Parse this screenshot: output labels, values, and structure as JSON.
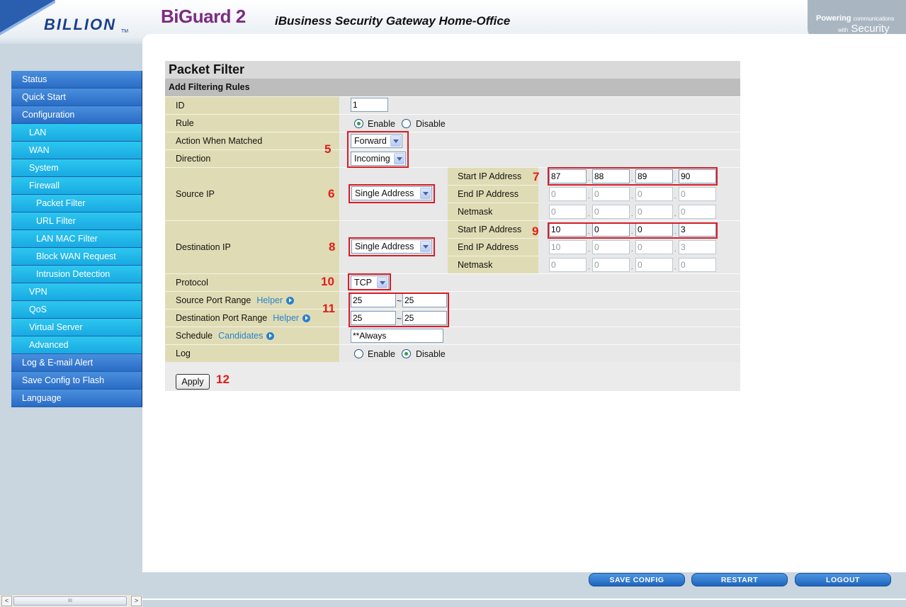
{
  "header": {
    "logo_text": "BILLION",
    "logo_tm": "TM",
    "product": "BiGuard 2",
    "subtitle": "iBusiness Security Gateway Home-Office",
    "powering": "Powering",
    "communications": "communications",
    "with": "with",
    "security": "Security"
  },
  "sidebar": {
    "items": [
      {
        "label": "Status",
        "level": 0
      },
      {
        "label": "Quick Start",
        "level": 0
      },
      {
        "label": "Configuration",
        "level": 0
      },
      {
        "label": "LAN",
        "level": 1
      },
      {
        "label": "WAN",
        "level": 1
      },
      {
        "label": "System",
        "level": 1
      },
      {
        "label": "Firewall",
        "level": 1
      },
      {
        "label": "Packet Filter",
        "level": 2
      },
      {
        "label": "URL Filter",
        "level": 2
      },
      {
        "label": "LAN MAC Filter",
        "level": 2
      },
      {
        "label": "Block WAN Request",
        "level": 2
      },
      {
        "label": "Intrusion Detection",
        "level": 2
      },
      {
        "label": "VPN",
        "level": 1
      },
      {
        "label": "QoS",
        "level": 1
      },
      {
        "label": "Virtual Server",
        "level": 1
      },
      {
        "label": "Advanced",
        "level": 1
      },
      {
        "label": "Log & E-mail Alert",
        "level": 0
      },
      {
        "label": "Save Config to Flash",
        "level": 0
      },
      {
        "label": "Language",
        "level": 0
      }
    ]
  },
  "page": {
    "title": "Packet Filter",
    "section": "Add Filtering Rules"
  },
  "form": {
    "id_label": "ID",
    "id_value": "1",
    "rule_label": "Rule",
    "enable": "Enable",
    "disable": "Disable",
    "rule_value": "enable",
    "action_label": "Action When Matched",
    "action_value": "Forward",
    "direction_label": "Direction",
    "direction_value": "Incoming",
    "source_ip_label": "Source IP",
    "source_mode": "Single Address",
    "start_ip_label": "Start IP Address",
    "end_ip_label": "End IP Address",
    "netmask_label": "Netmask",
    "src_start": [
      "87",
      "88",
      "89",
      "90"
    ],
    "src_end": [
      "0",
      "0",
      "0",
      "0"
    ],
    "src_mask": [
      "0",
      "0",
      "0",
      "0"
    ],
    "dest_ip_label": "Destination IP",
    "dest_mode": "Single Address",
    "dst_start": [
      "10",
      "0",
      "0",
      "3"
    ],
    "dst_end": [
      "10",
      "0",
      "0",
      "3"
    ],
    "dst_mask": [
      "0",
      "0",
      "0",
      "0"
    ],
    "protocol_label": "Protocol",
    "protocol_value": "TCP",
    "src_port_label": "Source Port Range",
    "helper": "Helper",
    "src_port_from": "25",
    "src_port_to": "25",
    "dst_port_label": "Destination Port Range",
    "dst_port_from": "25",
    "dst_port_to": "25",
    "tilde": "~",
    "schedule_label": "Schedule",
    "candidates": "Candidates",
    "schedule_value": "**Always",
    "log_label": "Log",
    "log_value": "disable",
    "apply": "Apply"
  },
  "annotations": [
    "5",
    "6",
    "7",
    "8",
    "9",
    "10",
    "11",
    "12"
  ],
  "bottom": {
    "save_config": "SAVE CONFIG",
    "restart": "RESTART",
    "logout": "LOGOUT"
  },
  "scrollbar": {
    "left": "<",
    "thumb": "III",
    "right": ">"
  }
}
